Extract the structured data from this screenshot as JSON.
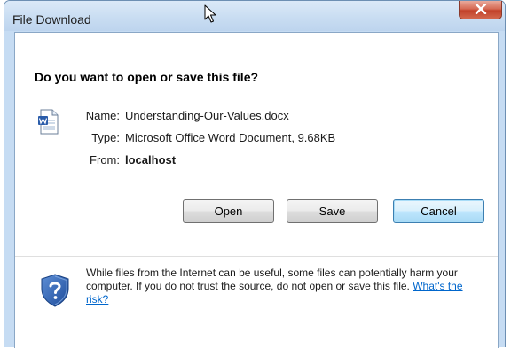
{
  "window": {
    "title": "File Download",
    "close_icon": "close-x-icon"
  },
  "dialog": {
    "question": "Do you want to open or save this file?",
    "file_icon": "word-document-icon",
    "info": [
      {
        "label": "Name:",
        "value": "Understanding-Our-Values.docx",
        "bold": false
      },
      {
        "label": "Type:",
        "value": "Microsoft Office Word Document, 9.68KB",
        "bold": false
      },
      {
        "label": "From:",
        "value": "localhost",
        "bold": true
      }
    ],
    "buttons": {
      "open": "Open",
      "save": "Save",
      "cancel": "Cancel"
    },
    "warning": {
      "icon": "security-shield-question-icon",
      "text": "While files from the Internet can be useful, some files can potentially harm your computer. If you do not trust the source, do not open or save this file.",
      "link": "What's the risk?"
    }
  },
  "colors": {
    "frame": "#c6dcf3",
    "close_button": "#c2422a",
    "default_button_border": "#3c7fb1",
    "link": "#0066cc"
  }
}
